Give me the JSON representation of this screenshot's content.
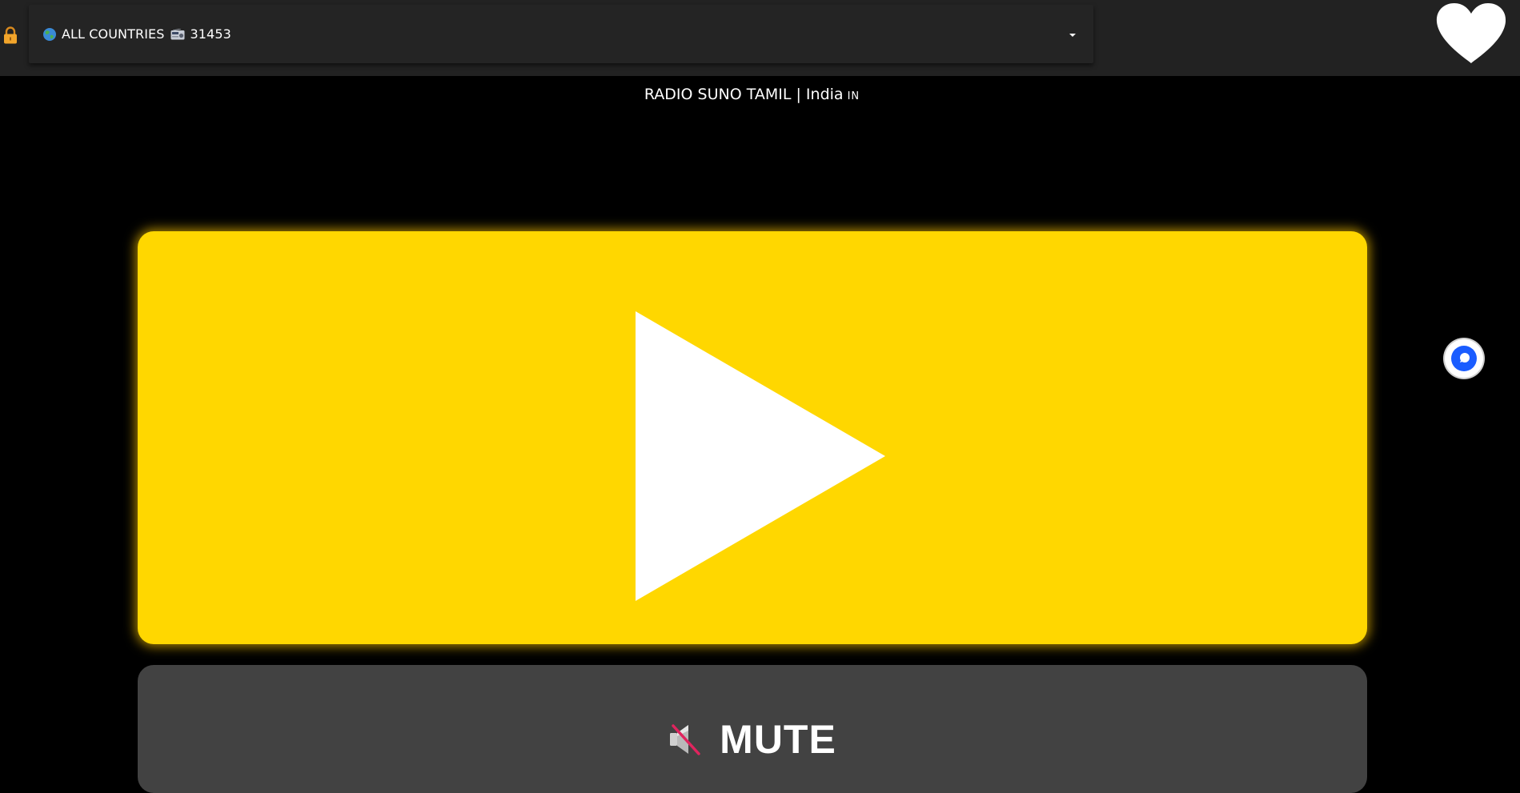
{
  "header": {
    "country_filter": {
      "label": "ALL COUNTRIES",
      "station_count": "31453",
      "icons": [
        "globe-icon",
        "radio-icon",
        "chevron-down-icon"
      ]
    },
    "lock_icon": "lock-icon",
    "favorite_icon": "heart-icon"
  },
  "station": {
    "name": "RADIO SUNO TAMIL",
    "separator": "|",
    "country": "India",
    "country_code": "IN"
  },
  "player": {
    "play_icon": "play-icon",
    "mute_label": "MUTE",
    "mute_icon": "speaker-muted-icon"
  },
  "side_widget_icon": "assistant-icon",
  "colors": {
    "topbar": "#222222",
    "background": "#000000",
    "play_panel": "#ffd700",
    "mute_panel": "#424242",
    "text": "#ffffff",
    "widget_blue": "#1a5cff"
  }
}
